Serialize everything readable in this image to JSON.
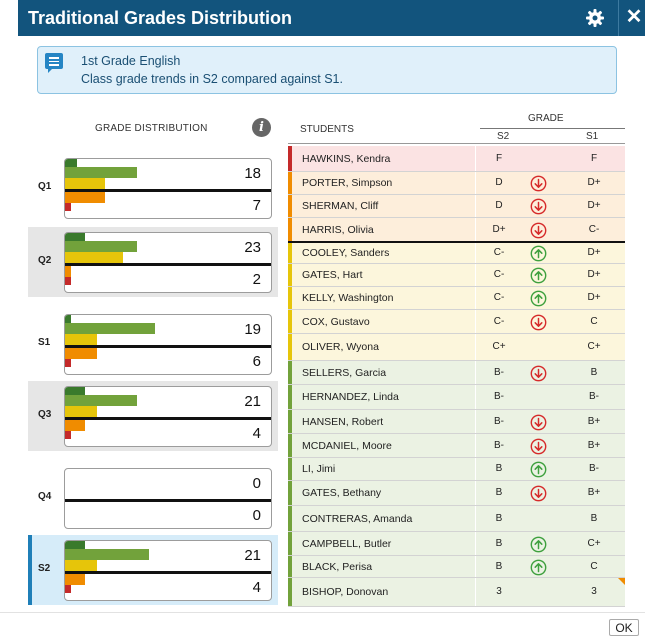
{
  "window": {
    "title": "Traditional Grades Distribution"
  },
  "info": {
    "line1": "1st Grade English",
    "line2": "Class grade trends in S2 compared against S1."
  },
  "left_header": "GRADE DISTRIBUTION",
  "info_button": "i",
  "colors": {
    "green": "#72a23b",
    "dark_green": "#3a7a2c",
    "yellow": "#e6c50a",
    "orange": "#f08c00",
    "red": "#c42a2a",
    "header_blue": "#12547d",
    "up_arrow": "#3ea03e",
    "down_arrow": "#d62a2a"
  },
  "periods": [
    {
      "label": "Q1",
      "above": "18",
      "below": "7",
      "style": "white",
      "levels": {
        "dark_green": 0.06,
        "green": 0.36,
        "yellow": 0.2,
        "orange": 0.2,
        "red": 0.03
      }
    },
    {
      "label": "Q2",
      "above": "23",
      "below": "2",
      "style": "gray",
      "levels": {
        "dark_green": 0.1,
        "green": 0.36,
        "yellow": 0.29,
        "orange": 0.03,
        "red": 0.03
      }
    },
    {
      "label": "S1",
      "above": "19",
      "below": "6",
      "style": "white",
      "levels": {
        "dark_green": 0.03,
        "green": 0.45,
        "yellow": 0.16,
        "orange": 0.16,
        "red": 0.03
      }
    },
    {
      "label": "Q3",
      "above": "21",
      "below": "4",
      "style": "gray",
      "levels": {
        "dark_green": 0.1,
        "green": 0.36,
        "yellow": 0.16,
        "orange": 0.1,
        "red": 0.03
      }
    },
    {
      "label": "Q4",
      "above": "0",
      "below": "0",
      "style": "white",
      "levels": {
        "dark_green": 0,
        "green": 0,
        "yellow": 0,
        "orange": 0,
        "red": 0
      }
    },
    {
      "label": "S2",
      "above": "21",
      "below": "4",
      "style": "selected",
      "levels": {
        "dark_green": 0.1,
        "green": 0.42,
        "yellow": 0.16,
        "orange": 0.1,
        "red": 0.03
      }
    }
  ],
  "students_header": "STUDENTS",
  "grade_header": "GRADE",
  "s2_header": "S2",
  "s1_header": "S1",
  "students": [
    {
      "name": "HAWKINS, Kendra",
      "s2": "F",
      "s1": "F",
      "trend": "none",
      "band": "red"
    },
    {
      "name": "PORTER, Simpson",
      "s2": "D",
      "s1": "D+",
      "trend": "down",
      "band": "orange"
    },
    {
      "name": "SHERMAN, Cliff",
      "s2": "D",
      "s1": "D+",
      "trend": "down",
      "band": "orange"
    },
    {
      "name": "HARRIS, Olivia",
      "s2": "D+",
      "s1": "C-",
      "trend": "down",
      "band": "orange"
    },
    {
      "name": "COOLEY, Sanders",
      "s2": "C-",
      "s1": "D+",
      "trend": "up",
      "band": "yellow"
    },
    {
      "name": "GATES, Hart",
      "s2": "C-",
      "s1": "D+",
      "trend": "up",
      "band": "yellow"
    },
    {
      "name": "KELLY, Washington",
      "s2": "C-",
      "s1": "D+",
      "trend": "up",
      "band": "yellow"
    },
    {
      "name": "COX, Gustavo",
      "s2": "C-",
      "s1": "C",
      "trend": "down",
      "band": "yellow"
    },
    {
      "name": "OLIVER, Wyona",
      "s2": "C+",
      "s1": "C+",
      "trend": "none",
      "band": "yellow"
    },
    {
      "name": "SELLERS, Garcia",
      "s2": "B-",
      "s1": "B",
      "trend": "down",
      "band": "green"
    },
    {
      "name": "HERNANDEZ, Linda",
      "s2": "B-",
      "s1": "B-",
      "trend": "none",
      "band": "green"
    },
    {
      "name": "HANSEN, Robert",
      "s2": "B-",
      "s1": "B+",
      "trend": "down",
      "band": "green"
    },
    {
      "name": "MCDANIEL, Moore",
      "s2": "B-",
      "s1": "B+",
      "trend": "down",
      "band": "green"
    },
    {
      "name": "LI, Jimi",
      "s2": "B",
      "s1": "B-",
      "trend": "up",
      "band": "green"
    },
    {
      "name": "GATES, Bethany",
      "s2": "B",
      "s1": "B+",
      "trend": "down",
      "band": "green"
    },
    {
      "name": "CONTRERAS, Amanda",
      "s2": "B",
      "s1": "B",
      "trend": "none",
      "band": "green"
    },
    {
      "name": "CAMPBELL, Butler",
      "s2": "B",
      "s1": "C+",
      "trend": "up",
      "band": "green"
    },
    {
      "name": "BLACK, Perisa",
      "s2": "B",
      "s1": "C",
      "trend": "up",
      "band": "green"
    },
    {
      "name": "BISHOP, Donovan",
      "s2": "3",
      "s1": "3",
      "trend": "none",
      "band": "green",
      "flag": true
    }
  ],
  "ok_label": "OK"
}
